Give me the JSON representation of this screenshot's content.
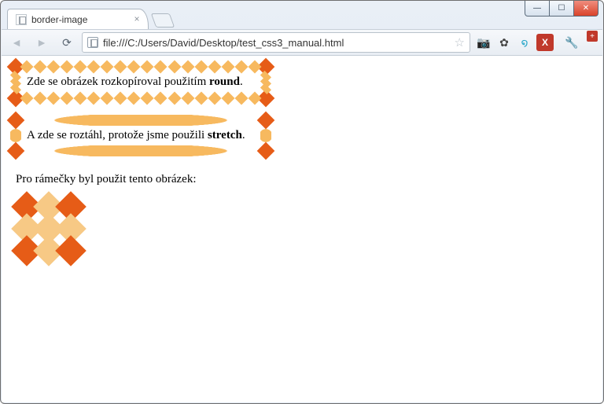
{
  "window": {
    "tab_title": "border-image",
    "sys": {
      "min": "—",
      "max": "☐",
      "close": "✕"
    }
  },
  "toolbar": {
    "back": "◄",
    "forward": "►",
    "reload": "⟳",
    "url": "file:///C:/Users/David/Desktop/test_css3_manual.html",
    "star": "☆",
    "ext_camera": "📷",
    "ext_gear": "✿",
    "ext_swirl": "໑",
    "ext_x": "X",
    "ext_plus": "+",
    "wrench": "🔧"
  },
  "page": {
    "box1_text": "Zde se obrázek rozkopíroval použitím ",
    "box1_bold": "round",
    "dot": ".",
    "box2_text": "A zde se roztáhl, protože jsme použili ",
    "box2_bold": "stretch",
    "caption": "Pro rámečky byl použit tento obrázek:"
  }
}
